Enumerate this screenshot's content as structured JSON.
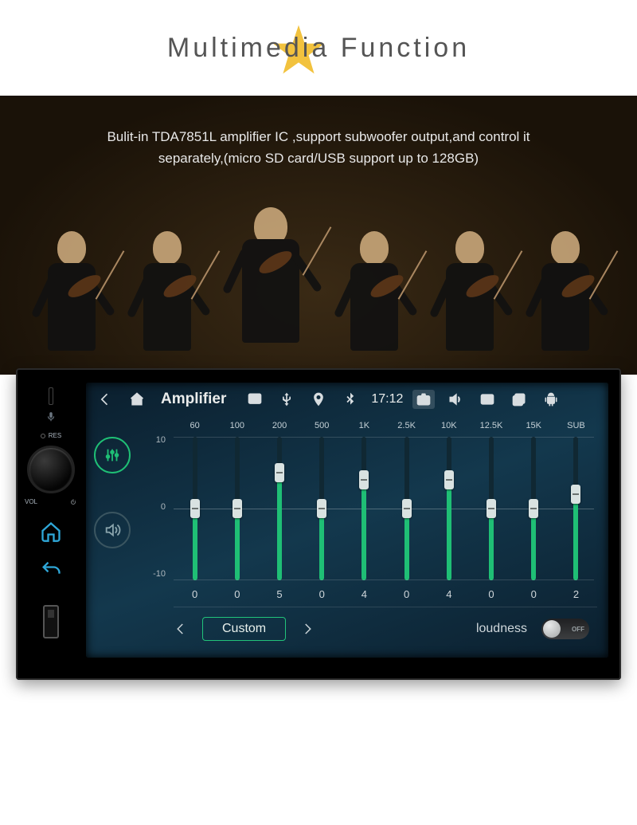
{
  "header": {
    "title": "Multimedia Function"
  },
  "hero": {
    "line1": "Bulit-in TDA7851L amplifier IC ,support subwoofer output,and control it",
    "line2": "separately,(micro SD card/USB support up to 128GB)"
  },
  "leftpanel": {
    "res": "RES",
    "vol": "VOL"
  },
  "statusbar": {
    "app_title": "Amplifier",
    "time": "17:12"
  },
  "eq": {
    "scale": {
      "top": "10",
      "mid": "0",
      "bot": "-10"
    },
    "bands": [
      {
        "freq": "60",
        "val": 0
      },
      {
        "freq": "100",
        "val": 0
      },
      {
        "freq": "200",
        "val": 5
      },
      {
        "freq": "500",
        "val": 0
      },
      {
        "freq": "1K",
        "val": 4
      },
      {
        "freq": "2.5K",
        "val": 0
      },
      {
        "freq": "10K",
        "val": 4
      },
      {
        "freq": "12.5K",
        "val": 0
      },
      {
        "freq": "15K",
        "val": 0
      },
      {
        "freq": "SUB",
        "val": 2
      }
    ],
    "preset": "Custom",
    "loudness_label": "loudness",
    "toggle_state": "OFF"
  }
}
